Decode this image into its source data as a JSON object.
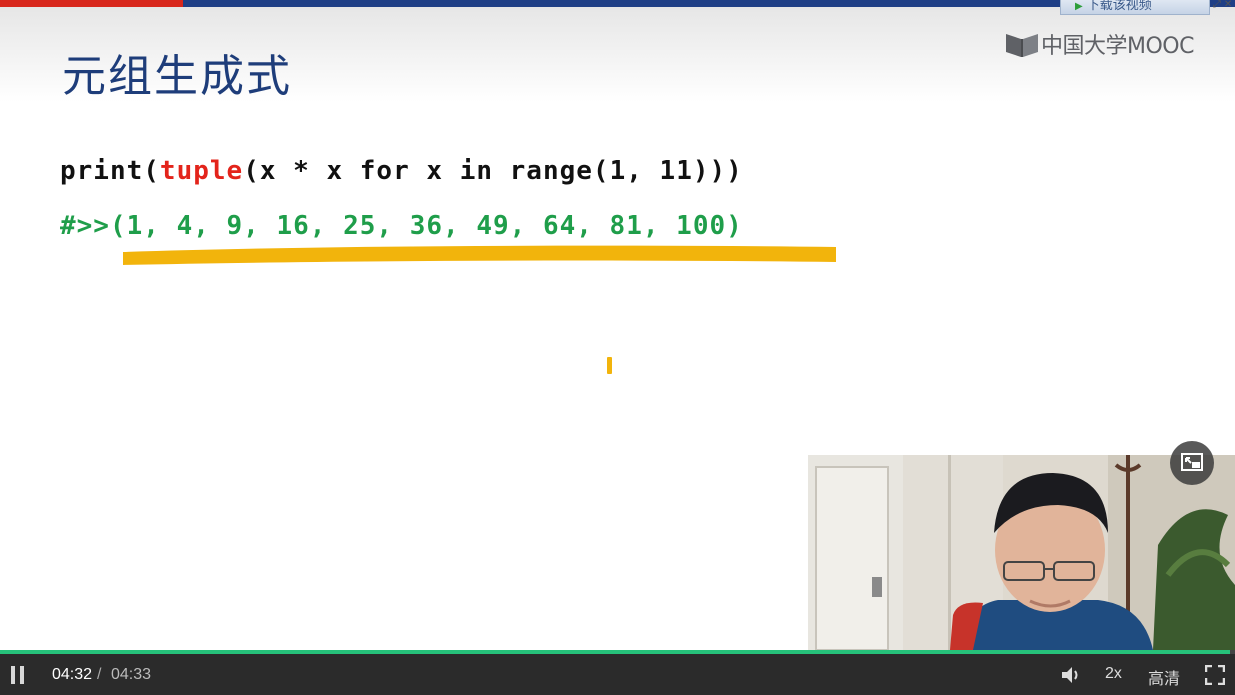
{
  "slide": {
    "title": "元组生成式",
    "logo_text": "中国大学MOOC",
    "code": {
      "line1_pre": "print(",
      "line1_kw": "tuple",
      "line1_post": "(x * x for x in range(1, 11)))",
      "line2": "#>>(1, 4, 9, 16, 25, 36, 49, 64, 81, 100)"
    }
  },
  "top": {
    "download_label": "下载该视频",
    "download_icon": "play-icon",
    "close_icon": "close-icon"
  },
  "player": {
    "current_time": "04:32",
    "separator": "/",
    "total_time": "04:33",
    "progress": 0.996,
    "speed": "2x",
    "quality": "高清",
    "icons": [
      "pause-icon",
      "volume-icon",
      "fullscreen-icon",
      "picture-in-picture-icon"
    ]
  },
  "colors": {
    "title": "#1e3d7a",
    "keyword": "#e3241b",
    "output": "#1f9e4a",
    "highlight": "#f2b40c",
    "progress": "#26c17a"
  }
}
